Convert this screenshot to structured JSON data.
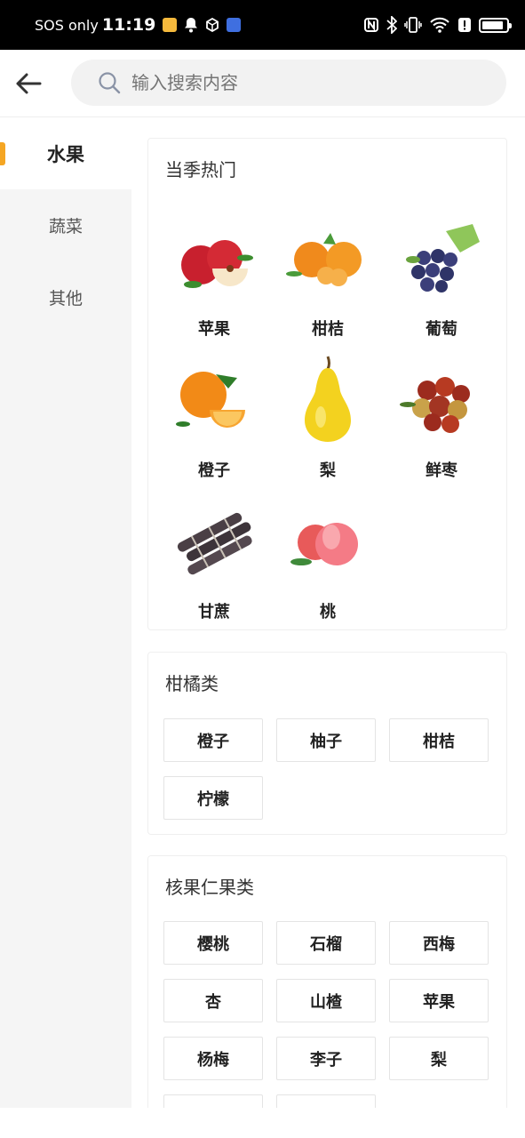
{
  "status_bar": {
    "carrier": "SOS only",
    "time": "11:19",
    "left_icons": [
      "app-notification-icon",
      "bell-icon",
      "box-icon",
      "bird-app-icon"
    ],
    "right_icons": [
      "nfc-icon",
      "bluetooth-icon",
      "vibrate-icon",
      "wifi-icon",
      "alert-icon",
      "battery-icon"
    ],
    "battery_level": 0.9
  },
  "header": {
    "back_icon": "arrow-left-icon",
    "search_placeholder": "输入搜索内容"
  },
  "sidebar": {
    "items": [
      {
        "label": "水果",
        "active": true
      },
      {
        "label": "蔬菜",
        "active": false
      },
      {
        "label": "其他",
        "active": false
      }
    ]
  },
  "sections": {
    "hot": {
      "title": "当季热门",
      "items": [
        "苹果",
        "柑桔",
        "葡萄",
        "橙子",
        "梨",
        "鲜枣",
        "甘蔗",
        "桃"
      ]
    },
    "citrus": {
      "title": "柑橘类",
      "items": [
        "橙子",
        "柚子",
        "柑桔",
        "柠檬"
      ]
    },
    "stone": {
      "title": "核果仁果类",
      "items": [
        "樱桃",
        "石榴",
        "西梅",
        "杏",
        "山楂",
        "苹果",
        "杨梅",
        "李子",
        "梨"
      ]
    }
  },
  "colors": {
    "accent": "#f5a623",
    "sidebar_bg": "#f5f5f5"
  }
}
